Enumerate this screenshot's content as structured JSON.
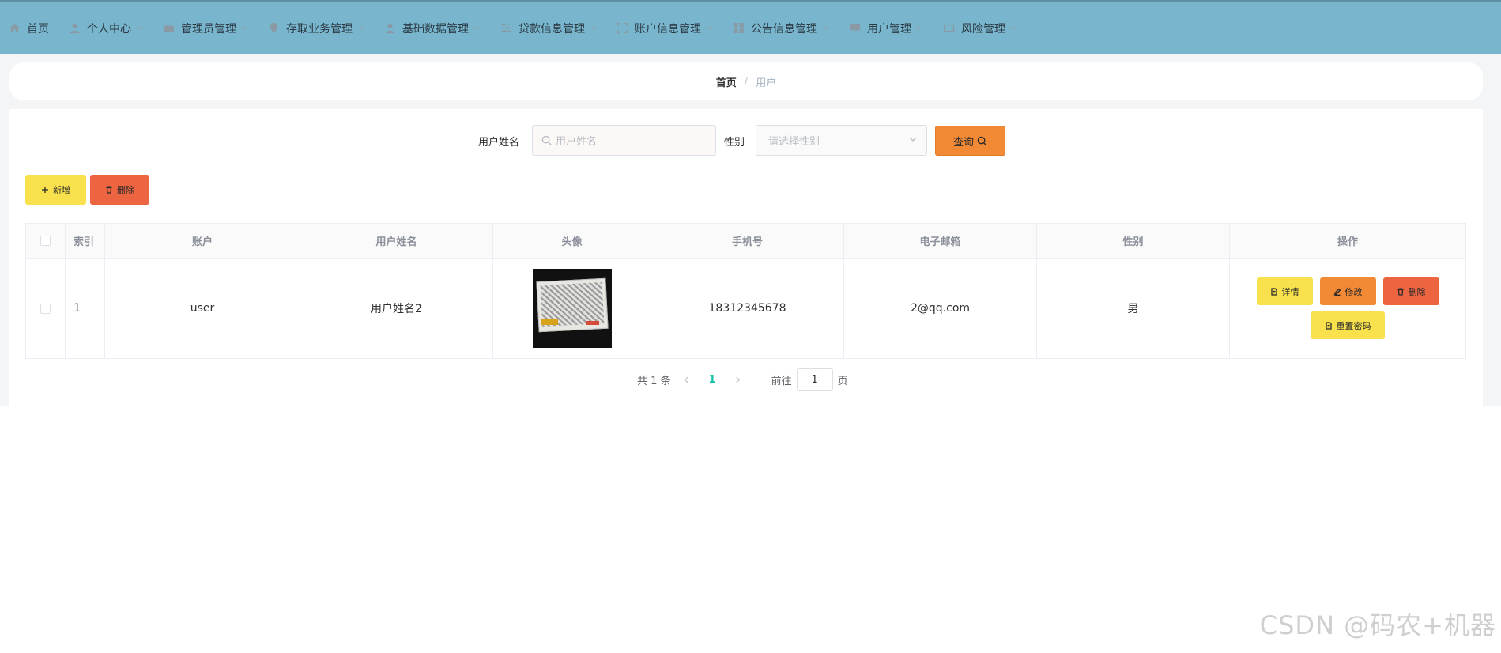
{
  "nav": {
    "items": [
      {
        "label": "首页",
        "icon": "home-icon"
      },
      {
        "label": "个人中心",
        "icon": "user-icon"
      },
      {
        "label": "管理员管理",
        "icon": "briefcase-icon"
      },
      {
        "label": "存取业务管理",
        "icon": "location-pin-icon"
      },
      {
        "label": "基础数据管理",
        "icon": "user-icon"
      },
      {
        "label": "贷款信息管理",
        "icon": "sliders-icon"
      },
      {
        "label": "账户信息管理",
        "icon": "full-screen-icon"
      },
      {
        "label": "公告信息管理",
        "icon": "grid-icon"
      },
      {
        "label": "用户管理",
        "icon": "monitor-icon"
      },
      {
        "label": "风险管理",
        "icon": "mail-icon"
      }
    ],
    "active_index": 8
  },
  "breadcrumb": {
    "home": "首页",
    "separator": "/",
    "current": "用户"
  },
  "search": {
    "name_label": "用户姓名",
    "name_placeholder": "用户姓名",
    "gender_label": "性别",
    "gender_placeholder": "请选择性别",
    "query_label": "查询"
  },
  "actions": {
    "add_label": "新增",
    "delete_label": "删除"
  },
  "table": {
    "headers": [
      "索引",
      "账户",
      "用户姓名",
      "头像",
      "手机号",
      "电子邮箱",
      "性别",
      "操作"
    ],
    "rows": [
      {
        "index": "1",
        "account": "user",
        "name": "用户姓名2",
        "phone": "18312345678",
        "email": "2@qq.com",
        "gender": "男"
      }
    ],
    "row_actions": {
      "detail": "详情",
      "edit": "修改",
      "delete": "删除",
      "reset": "重置密码"
    }
  },
  "pagination": {
    "total_text": "共 1 条",
    "current_page": "1",
    "goto_prefix": "前往",
    "goto_value": "1",
    "goto_suffix": "页"
  },
  "watermark": "CSDN @码农+机器",
  "colors": {
    "nav_bg": "#79b5cc",
    "accent_teal": "#13c2a8",
    "btn_yellow": "#f8e14c",
    "btn_orange": "#f28a35",
    "btn_red": "#ec6440"
  }
}
